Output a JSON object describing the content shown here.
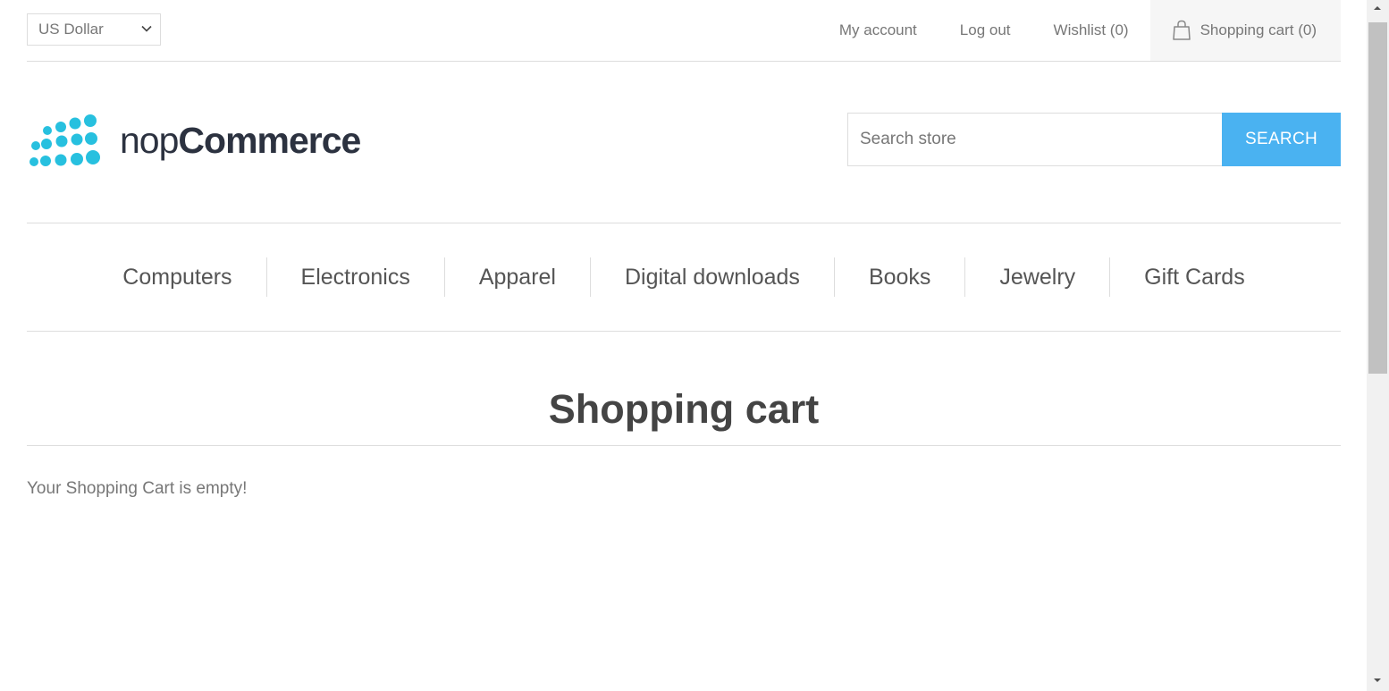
{
  "header": {
    "currency": "US Dollar",
    "links": {
      "my_account": "My account",
      "log_out": "Log out",
      "wishlist": "Wishlist (0)",
      "shopping_cart": "Shopping cart (0)"
    }
  },
  "logo": {
    "part1": "nop",
    "part2": "Commerce",
    "accent_color": "#27c0df"
  },
  "search": {
    "placeholder": "Search store",
    "button_label": "SEARCH",
    "button_color": "#4ab2f1"
  },
  "menu": {
    "items": [
      "Computers",
      "Electronics",
      "Apparel",
      "Digital downloads",
      "Books",
      "Jewelry",
      "Gift Cards"
    ]
  },
  "main": {
    "title": "Shopping cart",
    "empty_message": "Your Shopping Cart is empty!"
  },
  "icons": {
    "cart": "shopping-bag-icon",
    "currency_dropdown": "chevron-down-icon"
  }
}
